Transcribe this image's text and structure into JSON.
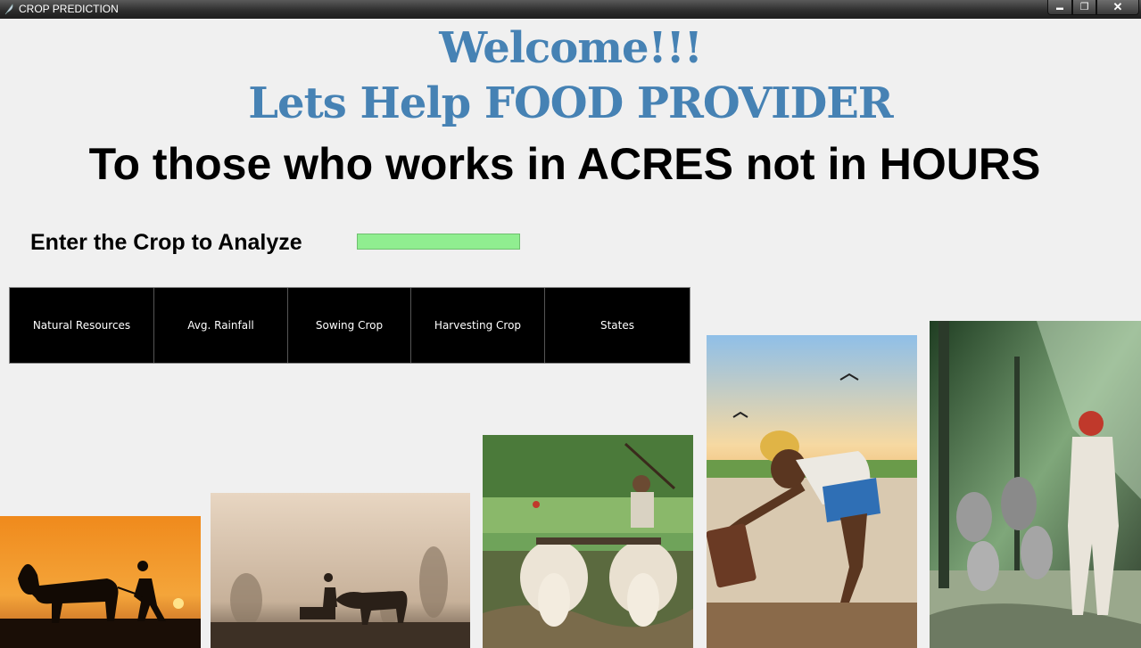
{
  "window": {
    "title": "CROP PREDICTION",
    "minimize_glyph": "▬",
    "maximize_glyph": "❐",
    "close_glyph": "✕"
  },
  "header": {
    "welcome": "Welcome!!!",
    "subtitle": "Lets Help FOOD PROVIDER",
    "tagline": "To those who works in ACRES not in HOURS"
  },
  "form": {
    "label": "Enter the Crop to Analyze",
    "input_value": "",
    "input_color": "#90ee90"
  },
  "buttons": [
    {
      "label": "Natural Resources"
    },
    {
      "label": "Avg. Rainfall"
    },
    {
      "label": "Sowing Crop"
    },
    {
      "label": "Harvesting Crop"
    },
    {
      "label": "States"
    }
  ],
  "colors": {
    "heading_blue": "#4682b4",
    "button_bg": "#000000",
    "background": "#f0f0f0"
  },
  "images": [
    {
      "name": "farmer-ox-sunset-photo"
    },
    {
      "name": "farmer-ox-fog-photo"
    },
    {
      "name": "farmer-plough-bulls-photo"
    },
    {
      "name": "farmer-digging-field-photo"
    },
    {
      "name": "farmer-walking-cattle-photo"
    }
  ]
}
